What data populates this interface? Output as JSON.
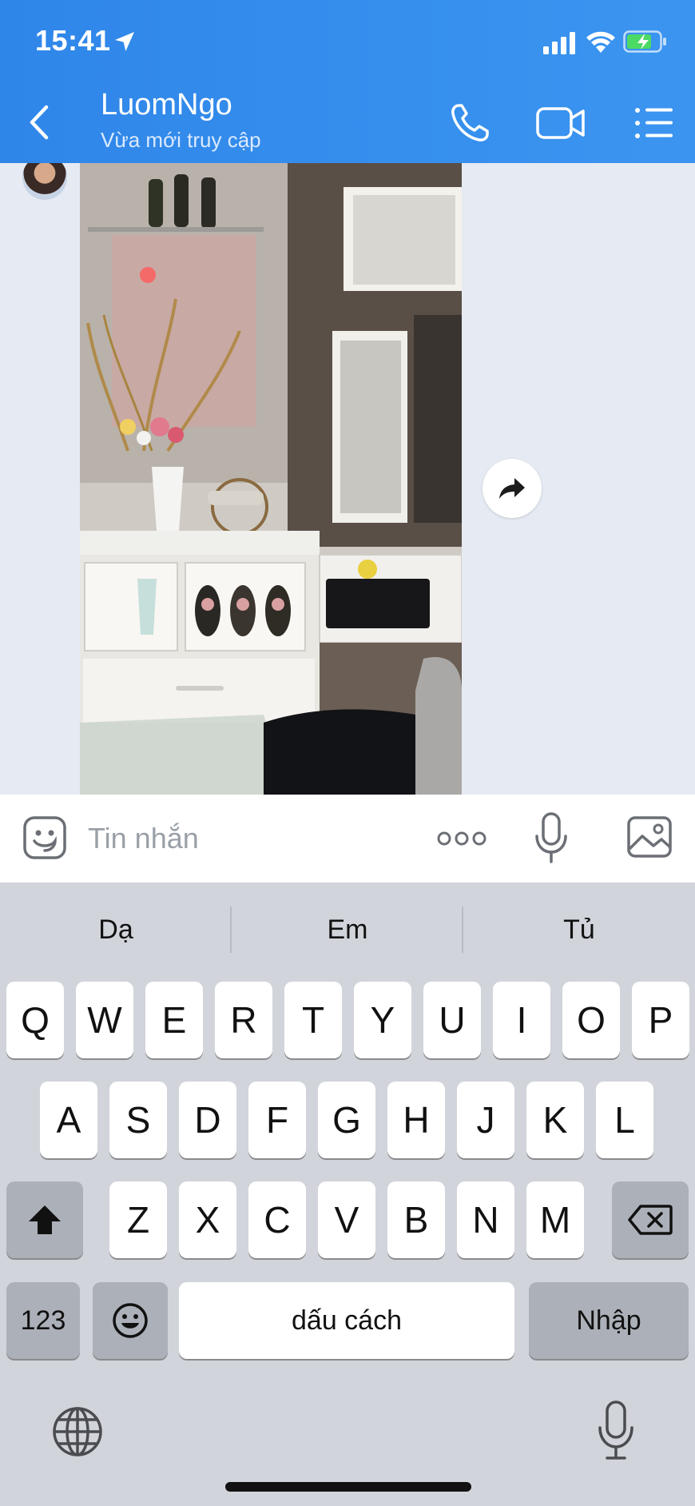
{
  "status_bar": {
    "time": "15:41"
  },
  "header": {
    "contact_name": "LuomNgo",
    "contact_status": "Vừa mới truy cập",
    "background": "#3590ee"
  },
  "input": {
    "placeholder": "Tin nhắn"
  },
  "keyboard": {
    "suggestions": [
      "Dạ",
      "Em",
      "Tủ"
    ],
    "row1": [
      "Q",
      "W",
      "E",
      "R",
      "T",
      "Y",
      "U",
      "I",
      "O",
      "P"
    ],
    "row2": [
      "A",
      "S",
      "D",
      "F",
      "G",
      "H",
      "J",
      "K",
      "L"
    ],
    "row3": [
      "Z",
      "X",
      "C",
      "V",
      "B",
      "N",
      "M"
    ],
    "numbers_label": "123",
    "space_label": "dấu cách",
    "return_label": "Nhập"
  }
}
